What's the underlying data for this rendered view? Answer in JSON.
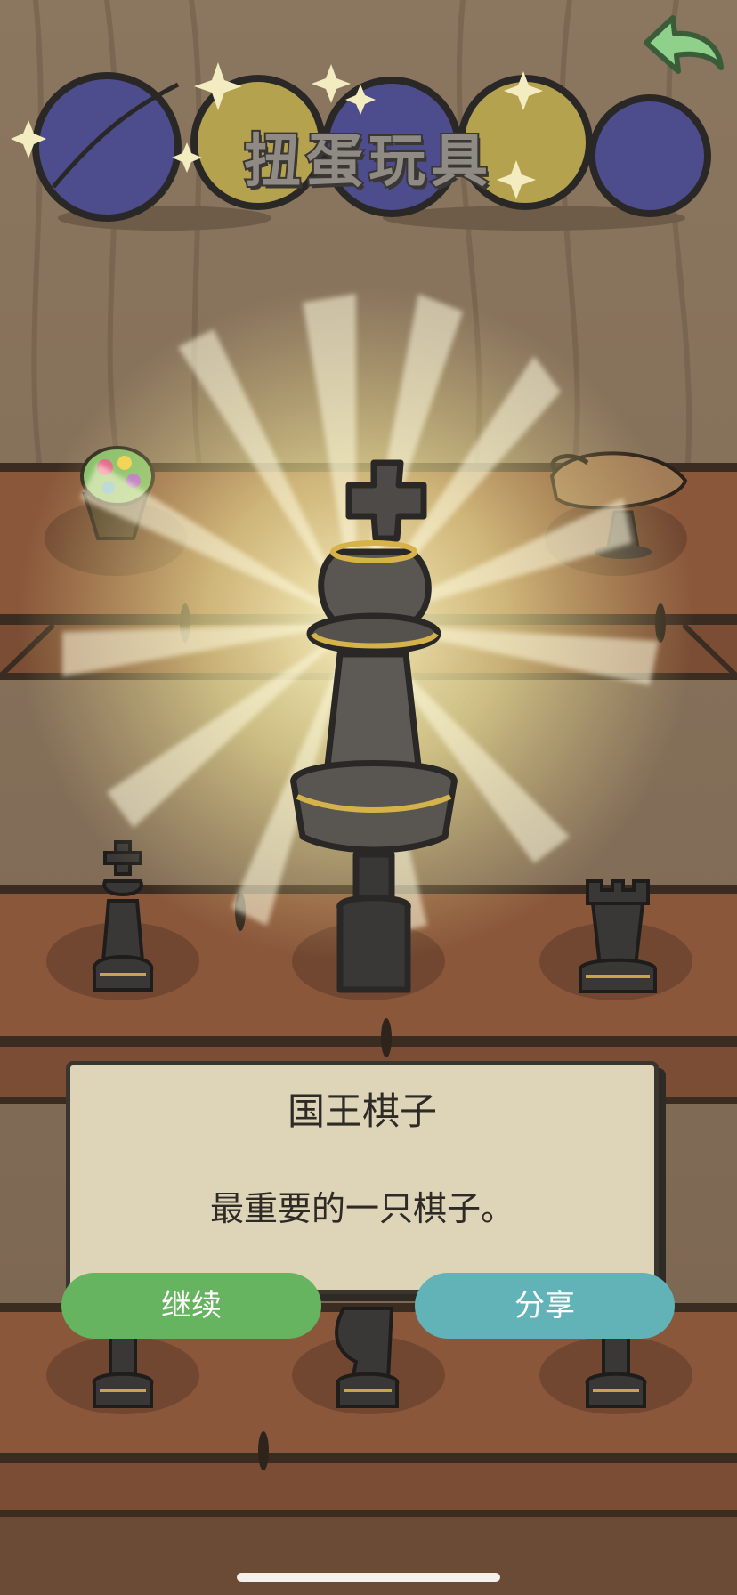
{
  "header": {
    "title": "扭蛋玩具"
  },
  "nav": {
    "back_icon": "back-arrow-icon",
    "back_color": "#8fd08a"
  },
  "featured_item": {
    "name": "国王棋子",
    "description": "最重要的一只棋子。",
    "icon": "chess-king-icon"
  },
  "shelf_items": [
    {
      "icon": "paint-palette-in-basket-icon"
    },
    {
      "icon": "turtle-shell-teapot-icon"
    },
    {
      "icon": "chess-king-icon"
    },
    {
      "icon": "chess-rook-icon"
    },
    {
      "icon": "chess-pawn-icon"
    },
    {
      "icon": "chess-knight-icon"
    },
    {
      "icon": "chess-pawn-icon"
    }
  ],
  "actions": {
    "continue_label": "继续",
    "share_label": "分享"
  },
  "colors": {
    "continue_button": "#66b45f",
    "share_button": "#62b3b8",
    "dialog_background": "#ded5b8",
    "capsule_blue": "#4d4c8c",
    "capsule_yellow": "#b5a24f"
  }
}
